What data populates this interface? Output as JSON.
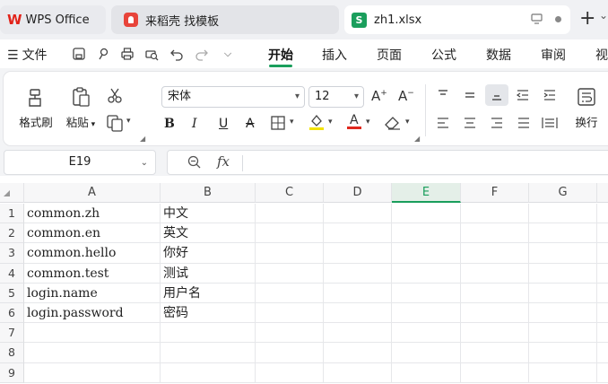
{
  "tabs": [
    {
      "label": "WPS Office"
    },
    {
      "label": "来稻壳 找模板"
    },
    {
      "label": "zh1.xlsx",
      "icon_letter": "S"
    }
  ],
  "menu": {
    "file_label": "文件",
    "items": [
      "开始",
      "插入",
      "页面",
      "公式",
      "数据",
      "审阅",
      "视"
    ],
    "active_index": 0
  },
  "ribbon": {
    "format_painter": "格式刷",
    "paste": "粘贴",
    "font": "宋体",
    "font_size": "12",
    "wrap": "换行"
  },
  "name_box": "E19",
  "formula_symbol": "fx",
  "columns": [
    "A",
    "B",
    "C",
    "D",
    "E",
    "F",
    "G"
  ],
  "selected_column": "E",
  "rows": [
    {
      "num": "1",
      "a": "common.zh",
      "b": "中文"
    },
    {
      "num": "2",
      "a": "common.en",
      "b": "英文"
    },
    {
      "num": "3",
      "a": "common.hello",
      "b": "你好"
    },
    {
      "num": "4",
      "a": "common.test",
      "b": "测试"
    },
    {
      "num": "5",
      "a": "login.name",
      "b": "用户名"
    },
    {
      "num": "6",
      "a": "login.password",
      "b": "密码"
    },
    {
      "num": "7",
      "a": "",
      "b": ""
    },
    {
      "num": "8",
      "a": "",
      "b": ""
    },
    {
      "num": "9",
      "a": "",
      "b": ""
    }
  ],
  "colors": {
    "accent": "#1a9e5c",
    "wps_red": "#e2231a",
    "daoke_red": "#e8443a"
  }
}
